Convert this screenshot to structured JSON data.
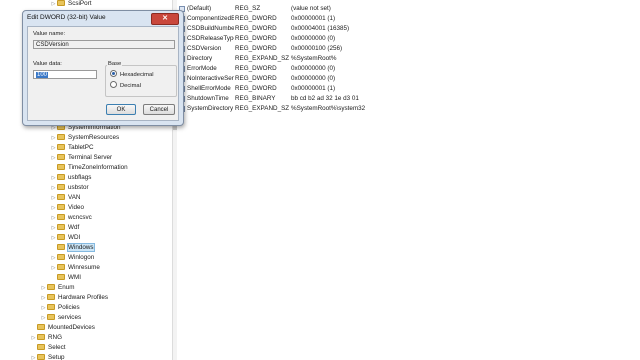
{
  "tree": {
    "items": [
      {
        "label": "ScsiPort",
        "expander": "▷"
      },
      {
        "label": "SystemInformation",
        "expander": "▷"
      },
      {
        "label": "SystemResources",
        "expander": "▷"
      },
      {
        "label": "TabletPC",
        "expander": "▷"
      },
      {
        "label": "Terminal Server",
        "expander": "▷"
      },
      {
        "label": "TimeZoneInformation",
        "expander": ""
      },
      {
        "label": "usbflags",
        "expander": "▷"
      },
      {
        "label": "usbstor",
        "expander": "▷"
      },
      {
        "label": "VAN",
        "expander": "▷"
      },
      {
        "label": "Video",
        "expander": "▷"
      },
      {
        "label": "wcncsvc",
        "expander": "▷"
      },
      {
        "label": "Wdf",
        "expander": "▷"
      },
      {
        "label": "WDI",
        "expander": "▷"
      },
      {
        "label": "Windows",
        "expander": ""
      },
      {
        "label": "Winlogon",
        "expander": "▷"
      },
      {
        "label": "Winresume",
        "expander": "▷"
      },
      {
        "label": "WMI",
        "expander": ""
      },
      {
        "label": "Enum",
        "expander": "▷"
      },
      {
        "label": "Hardware Profiles",
        "expander": "▷"
      },
      {
        "label": "Policies",
        "expander": "▷"
      },
      {
        "label": "services",
        "expander": "▷"
      },
      {
        "label": "MountedDevices",
        "expander": ""
      },
      {
        "label": "RNG",
        "expander": "▷"
      },
      {
        "label": "Select",
        "expander": ""
      },
      {
        "label": "Setup",
        "expander": "▷"
      }
    ]
  },
  "values": [
    {
      "name": "(Default)",
      "type": "REG_SZ",
      "data": "(value not set)"
    },
    {
      "name": "ComponentizedBuild",
      "type": "REG_DWORD",
      "data": "0x00000001 (1)"
    },
    {
      "name": "CSDBuildNumber",
      "type": "REG_DWORD",
      "data": "0x00004001 (16385)"
    },
    {
      "name": "CSDReleaseType",
      "type": "REG_DWORD",
      "data": "0x00000000 (0)"
    },
    {
      "name": "CSDVersion",
      "type": "REG_DWORD",
      "data": "0x00000100 (256)"
    },
    {
      "name": "Directory",
      "type": "REG_EXPAND_SZ",
      "data": "%SystemRoot%"
    },
    {
      "name": "ErrorMode",
      "type": "REG_DWORD",
      "data": "0x00000000 (0)"
    },
    {
      "name": "NoInteractiveServices",
      "type": "REG_DWORD",
      "data": "0x00000000 (0)"
    },
    {
      "name": "ShellErrorMode",
      "type": "REG_DWORD",
      "data": "0x00000001 (1)"
    },
    {
      "name": "ShutdownTime",
      "type": "REG_BINARY",
      "data": "bb cd b2 ad 32 1e d3 01"
    },
    {
      "name": "SystemDirectory",
      "type": "REG_EXPAND_SZ",
      "data": "%SystemRoot%\\system32"
    }
  ],
  "dialog": {
    "title": "Edit DWORD (32-bit) Value",
    "close_glyph": "✕",
    "value_name_label": "Value name:",
    "value_name": "CSDVersion",
    "value_data_label": "Value data:",
    "value_data": "100",
    "base_label": "Base",
    "hex_label": "Hexadecimal",
    "dec_label": "Decimal",
    "ok_label": "OK",
    "cancel_label": "Cancel"
  },
  "colors": {
    "accent": "#3a78c7",
    "close": "#c9473c",
    "folder": "#e8c45c"
  }
}
